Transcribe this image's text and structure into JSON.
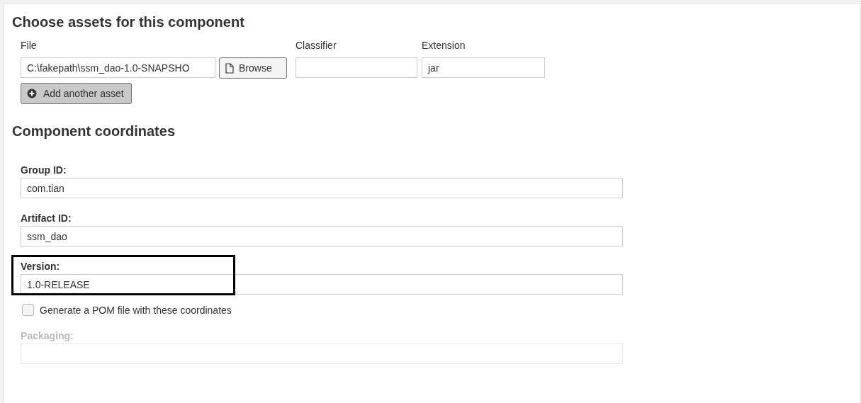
{
  "assets": {
    "title": "Choose assets for this component",
    "columns": [
      "File",
      "Classifier",
      "Extension"
    ],
    "file": {
      "value": "C:\\fakepath\\ssm_dao-1.0-SNAPSHO"
    },
    "browse_button": "Browse",
    "extension": {
      "value": "jar"
    },
    "add_button": "Add another asset"
  },
  "coordinates": {
    "title": "Component coordinates",
    "fields": [
      {
        "label": "Group ID:",
        "value": "com.tian",
        "highlighted": false
      },
      {
        "label": "Artifact ID:",
        "value": "ssm_dao",
        "highlighted": false
      },
      {
        "label": "Version:",
        "value": "1.0-RELEASE",
        "highlighted": true
      }
    ],
    "generate_pom": {
      "label": "Generate a POM file with these coordinates",
      "checked": false
    },
    "packaging": {
      "label": "Packaging:",
      "disabled": true
    }
  }
}
